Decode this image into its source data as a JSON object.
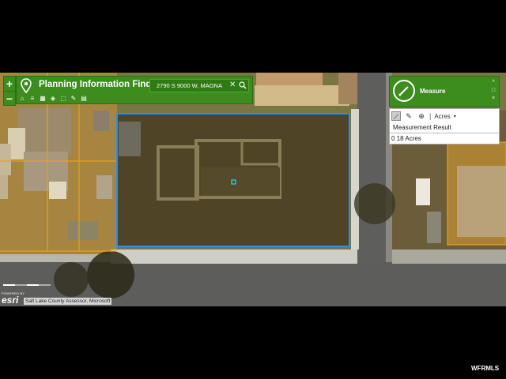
{
  "zoom": {
    "in_label": "+",
    "out_label": "−"
  },
  "finder": {
    "title": "Planning Information Finder",
    "search_value": "2790 S 9000 W, MAGNA",
    "clear_label": "✕",
    "tools": [
      "⌂",
      "≡",
      "▦",
      "◈",
      "⬚",
      "✎",
      "▤"
    ]
  },
  "measure": {
    "title": "Measure",
    "controls": [
      "^",
      "□",
      "×"
    ],
    "unit": "Acres",
    "result_label": "Measurement Result",
    "result_value": "0 18 Acres"
  },
  "map": {
    "attribution": "Salt Lake County Assessor, Microsoft",
    "powered_by": "POWERED BY",
    "esri_logo": "esri",
    "selection_color": "#1e90ff",
    "parcel_color": "#e6a21e"
  },
  "watermark": "WFRMLS"
}
